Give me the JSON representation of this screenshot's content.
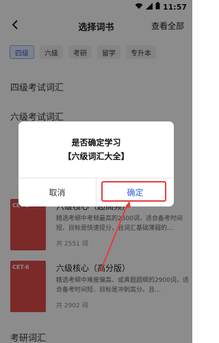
{
  "status": {
    "time": "11:57"
  },
  "nav": {
    "title": "选择词书",
    "action": "查看全部"
  },
  "tabs": [
    {
      "label": "四级",
      "active": true
    },
    {
      "label": "六级",
      "active": false
    },
    {
      "label": "考研",
      "active": false
    },
    {
      "label": "留学",
      "active": false
    },
    {
      "label": "专升本",
      "active": false
    }
  ],
  "sections": {
    "cet4": "四级考试词汇",
    "cet6": "六级考试词汇",
    "kaoyan": "考研词汇"
  },
  "books": [
    {
      "title": "六级核心（超高频）",
      "cover_label": "CET-6",
      "description": "精选考纲中考频最高的2500词，适合备考时间短、目标是快速提分，且词汇基础薄弱的…",
      "count": "共 2551 词"
    },
    {
      "title": "六级核心（高分版）",
      "cover_label": "CET-6",
      "description": "精选考纲中难度偏高、或真题超纲的2900词，适合备考时间短、目标是冲刺高分。且…",
      "count": "共 2902 词"
    }
  ],
  "dialog": {
    "message_line1": "是否确定学习",
    "message_line2": "【六级词汇大全】",
    "cancel": "取消",
    "confirm": "确定"
  },
  "colors": {
    "accent": "#2f62d8",
    "cover": "#e24c4c",
    "highlight": "#e43c3c"
  }
}
